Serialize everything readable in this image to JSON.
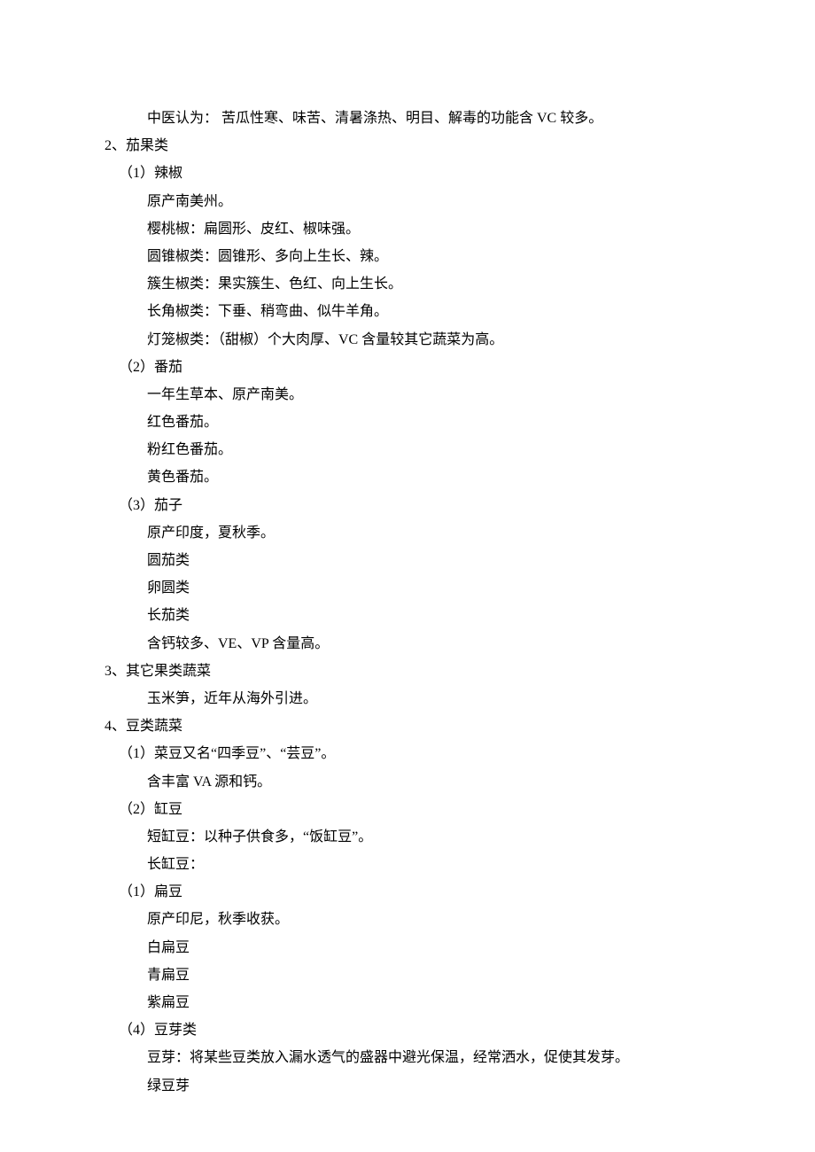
{
  "lines": [
    {
      "cls": "indent-0",
      "text": "　　　中医认为： 苦瓜性寒、味苦、清暑涤热、明目、解毒的功能含 VC 较多。"
    },
    {
      "cls": "indent-0",
      "text": "2、茄果类"
    },
    {
      "cls": "indent-2",
      "text": "（1）辣椒"
    },
    {
      "cls": "indent-3",
      "text": "原产南美州。"
    },
    {
      "cls": "indent-3",
      "text": "樱桃椒：扁圆形、皮红、椒味强。"
    },
    {
      "cls": "indent-3",
      "text": "圆锥椒类：圆锥形、多向上生长、辣。"
    },
    {
      "cls": "indent-3",
      "text": "簇生椒类：果实簇生、色红、向上生长。"
    },
    {
      "cls": "indent-3",
      "text": "长角椒类：下垂、稍弯曲、似牛羊角。"
    },
    {
      "cls": "indent-3",
      "text": "灯笼椒类：（甜椒）个大肉厚、VC 含量较其它蔬菜为高。"
    },
    {
      "cls": "indent-2",
      "text": "（2）番茄"
    },
    {
      "cls": "indent-3",
      "text": "一年生草本、原产南美。"
    },
    {
      "cls": "indent-3",
      "text": "红色番茄。"
    },
    {
      "cls": "indent-3",
      "text": "粉红色番茄。"
    },
    {
      "cls": "indent-3",
      "text": "黄色番茄。"
    },
    {
      "cls": "indent-2",
      "text": "（3）茄子"
    },
    {
      "cls": "indent-3",
      "text": "原产印度，夏秋季。"
    },
    {
      "cls": "indent-3",
      "text": "圆茄类"
    },
    {
      "cls": "indent-3",
      "text": "卵圆类"
    },
    {
      "cls": "indent-3",
      "text": "长茄类"
    },
    {
      "cls": "indent-3",
      "text": "含钙较多、VE、VP 含量高。"
    },
    {
      "cls": "indent-0",
      "text": "3、其它果类蔬菜"
    },
    {
      "cls": "indent-3",
      "text": "玉米笋，近年从海外引进。"
    },
    {
      "cls": "indent-0",
      "text": "4、豆类蔬菜"
    },
    {
      "cls": "indent-2",
      "text": "（1）菜豆又名“四季豆”、“芸豆”。"
    },
    {
      "cls": "indent-3",
      "text": "含丰富 VA 源和钙。"
    },
    {
      "cls": "indent-2",
      "text": "（2）缸豆"
    },
    {
      "cls": "indent-3",
      "text": "短缸豆：以种子供食多，“饭缸豆”。"
    },
    {
      "cls": "indent-3",
      "text": "长缸豆："
    },
    {
      "cls": "indent-2",
      "text": "（1）扁豆"
    },
    {
      "cls": "indent-3",
      "text": "原产印尼，秋季收获。"
    },
    {
      "cls": "indent-3",
      "text": "白扁豆"
    },
    {
      "cls": "indent-3",
      "text": "青扁豆"
    },
    {
      "cls": "indent-3",
      "text": "紫扁豆"
    },
    {
      "cls": "indent-2",
      "text": "（4）豆芽类"
    },
    {
      "cls": "indent-0",
      "text": "　　　豆芽：将某些豆类放入漏水透气的盛器中避光保温，经常洒水，促使其发芽。"
    },
    {
      "cls": "indent-3",
      "text": "绿豆芽"
    }
  ]
}
